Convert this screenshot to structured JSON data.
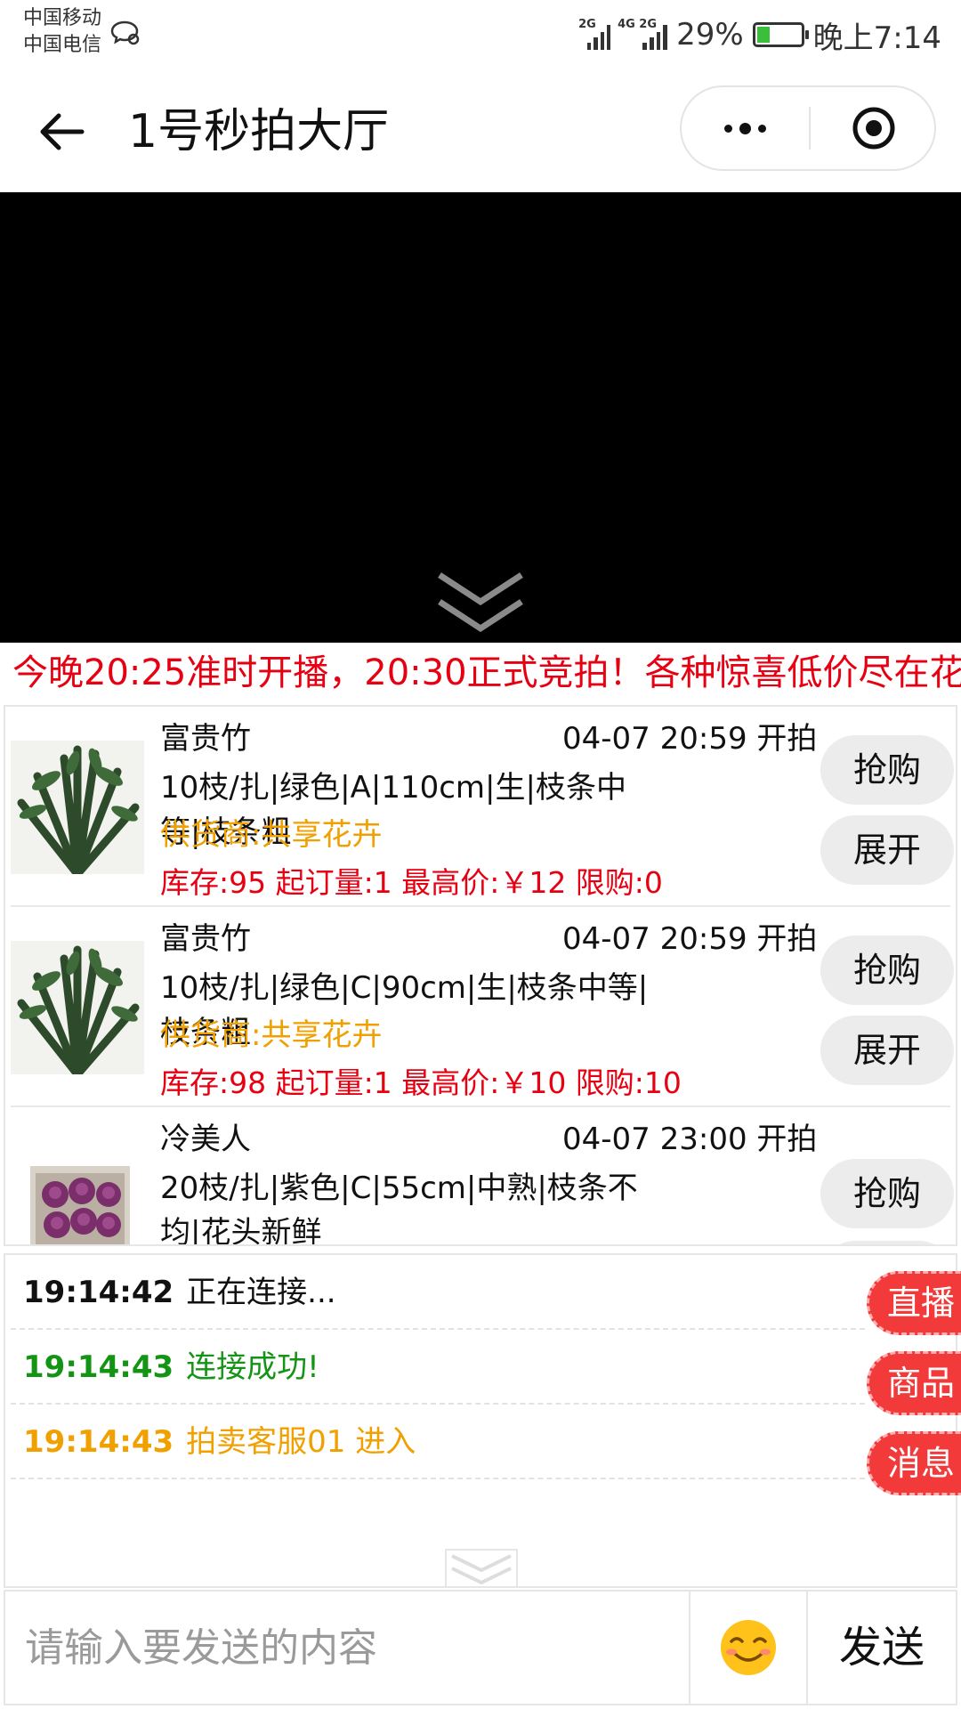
{
  "status_bar": {
    "carrier_1": "中国移动",
    "carrier_2": "中国电信",
    "network_1": "2G",
    "network_2": "4G 2G",
    "battery_text": "29%",
    "battery_level": 0.29,
    "time": "晚上7:14"
  },
  "title_bar": {
    "title": "1号秒拍大厅",
    "icons": [
      "back-arrow-icon",
      "more-dots-icon",
      "close-target-icon"
    ]
  },
  "video": {
    "background": "#000000",
    "collapse_icon": "double-chevron-down-icon"
  },
  "marquee_text": "今晚20:25准时开播，20:30正式竞拍！各种惊喜低价尽在花",
  "products": [
    {
      "name": "富贵竹",
      "time": "04-07 20:59 开拍",
      "spec": "10枝/扎|绿色|A|110cm|生|枝条中等|枝条粗",
      "supplier": "供货商:共享花卉",
      "stock": "库存:95 起订量:1 最高价:￥12 限购:0",
      "buy_label": "抢购",
      "expand_label": "展开"
    },
    {
      "name": "富贵竹",
      "time": "04-07 20:59 开拍",
      "spec": "10枝/扎|绿色|C|90cm|生|枝条中等|枝条粗",
      "supplier": "供货商:共享花卉",
      "stock": "库存:98 起订量:1 最高价:￥10 限购:10",
      "buy_label": "抢购",
      "expand_label": "展开"
    },
    {
      "name": "冷美人",
      "time": "04-07 23:00 开拍",
      "spec": "20枝/扎|紫色|C|55cm|中熟|枝条不均|花头新鲜",
      "buy_label": "抢购"
    }
  ],
  "messages": [
    {
      "time": "19:14:42",
      "text": "正在连接...",
      "color": "#111111"
    },
    {
      "time": "19:14:43",
      "text": "连接成功!",
      "color": "#149414"
    },
    {
      "time": "19:14:43",
      "text": "拍卖客服01 进入",
      "color": "#f0a000"
    }
  ],
  "side_buttons": {
    "live": "直播",
    "goods": "商品",
    "messages": "消息",
    "color": "#f23a3a"
  },
  "input_bar": {
    "placeholder": "请输入要发送的内容",
    "emoji_icon": "smiling-face-icon",
    "send_label": "发送"
  },
  "colors": {
    "marquee": "#e60012",
    "supplier": "#f0a000",
    "stock": "#e60012"
  }
}
